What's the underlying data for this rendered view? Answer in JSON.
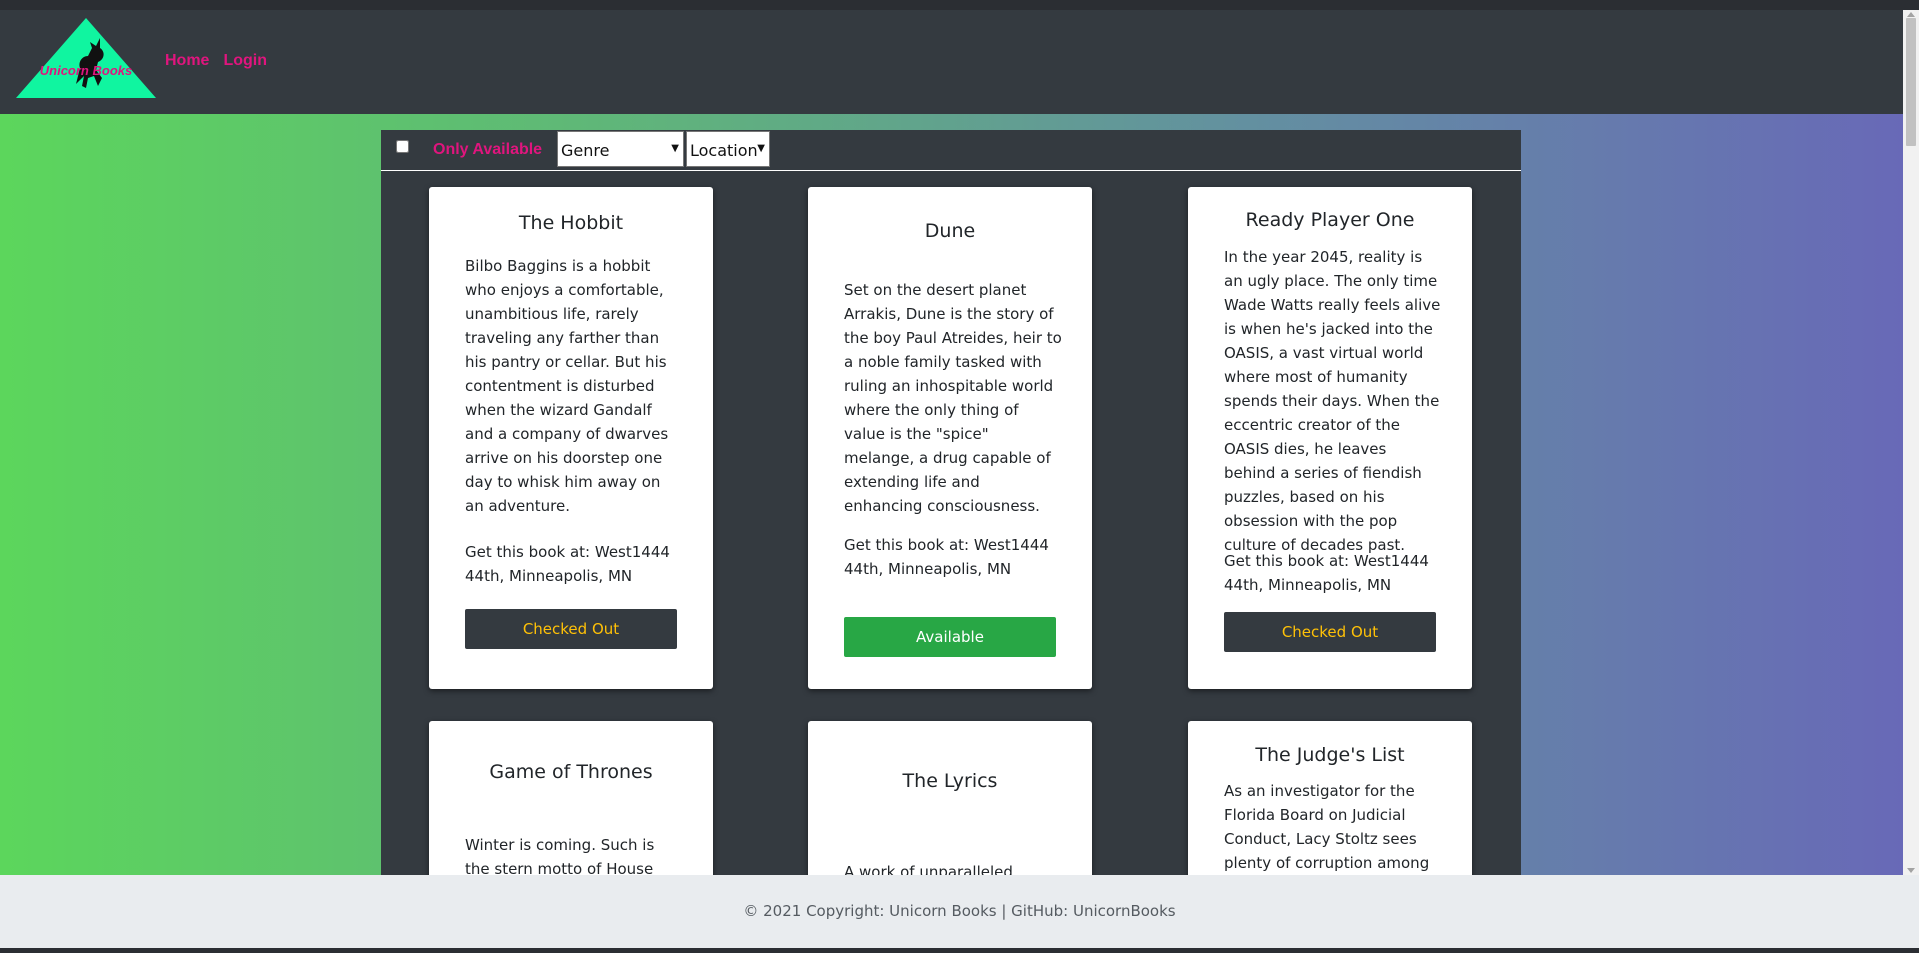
{
  "brand": {
    "name": "Unicorn Books"
  },
  "nav": {
    "home": "Home",
    "login": "Login"
  },
  "filters": {
    "only_available": "Only Available",
    "genre": "Genre",
    "location": "Location"
  },
  "books": [
    {
      "title": "The Hobbit",
      "description": "Bilbo Baggins is a hobbit who enjoys a comfortable, unambitious life, rarely traveling any farther than his pantry or cellar. But his contentment is disturbed when the wizard Gandalf and a company of dwarves arrive on his doorstep one day to whisk him away on an adventure.",
      "location": "Get this book at: West1444 44th, Minneapolis, MN",
      "status": "Checked Out"
    },
    {
      "title": "Dune",
      "description": "Set on the desert planet Arrakis, Dune is the story of the boy Paul Atreides, heir to a noble family tasked with ruling an inhospitable world where the only thing of value is the \"spice\" melange, a drug capable of extending life and enhancing consciousness.",
      "location": "Get this book at: West1444 44th, Minneapolis, MN",
      "status": "Available"
    },
    {
      "title": "Ready Player One",
      "description": "In the year 2045, reality is an ugly place. The only time Wade Watts really feels alive is when he's jacked into the OASIS, a vast virtual world where most of humanity spends their days. When the eccentric creator of the OASIS dies, he leaves behind a series of fiendish puzzles, based on his obsession with the pop culture of decades past.",
      "location": "Get this book at: West1444 44th, Minneapolis, MN",
      "status": "Checked Out"
    },
    {
      "title": "Game of Thrones",
      "description": "Winter is coming. Such is the stern motto of House Stark,"
    },
    {
      "title": "The Lyrics",
      "description": "A work of unparalleled"
    },
    {
      "title": "The Judge's List",
      "description": "As an investigator for the Florida Board on Judicial Conduct, Lacy Stoltz sees plenty of corruption among"
    }
  ],
  "footer": {
    "text": "© 2021 Copyright: Unicorn Books | GitHub: UnicornBooks"
  },
  "colors": {
    "nav_link": "#e0157e",
    "navbar": "#343a40",
    "checked_out_text": "#ffc107",
    "available_bg": "#28a745",
    "logo_triangle": "#10f5a0"
  }
}
